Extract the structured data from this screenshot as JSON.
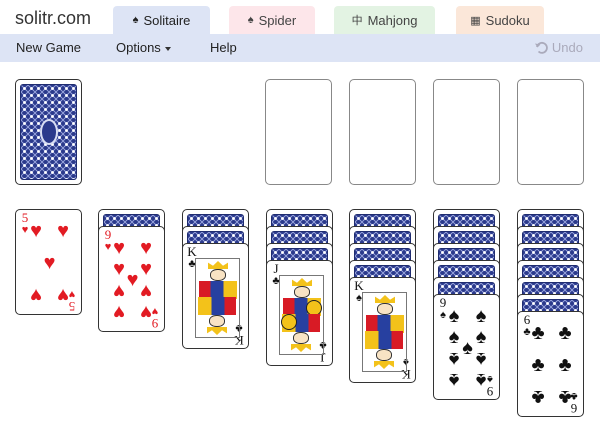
{
  "site": {
    "logo": "solitr.com"
  },
  "tabs": [
    {
      "label": "Solitaire",
      "icon": "spade-icon",
      "glyph": "♠",
      "active": true
    },
    {
      "label": "Spider",
      "icon": "spade-icon",
      "glyph": "♠",
      "active": false
    },
    {
      "label": "Mahjong",
      "icon": "mahjong-tile-icon",
      "glyph": "中",
      "active": false
    },
    {
      "label": "Sudoku",
      "icon": "grid-icon",
      "glyph": "▦",
      "active": false
    }
  ],
  "menu": {
    "new_game": "New Game",
    "options": "Options",
    "help": "Help",
    "undo": "Undo"
  },
  "colors": {
    "menubar": "#dde4f5",
    "card_back": "#2b3a8c",
    "red_suit": "#e21b23"
  },
  "game": {
    "stock": {
      "has_cards": true
    },
    "foundations": [
      {
        "empty": true
      },
      {
        "empty": true
      },
      {
        "empty": true
      },
      {
        "empty": true
      }
    ],
    "tableau": [
      {
        "face_down": 0,
        "face_up": [
          {
            "rank": "5",
            "suit": "♥",
            "color": "red"
          }
        ]
      },
      {
        "face_down": 1,
        "face_up": [
          {
            "rank": "9",
            "suit": "♥",
            "color": "red"
          }
        ]
      },
      {
        "face_down": 2,
        "face_up": [
          {
            "rank": "K",
            "suit": "♣",
            "color": "black"
          }
        ]
      },
      {
        "face_down": 3,
        "face_up": [
          {
            "rank": "J",
            "suit": "♣",
            "color": "black"
          }
        ]
      },
      {
        "face_down": 4,
        "face_up": [
          {
            "rank": "K",
            "suit": "♠",
            "color": "black"
          }
        ]
      },
      {
        "face_down": 5,
        "face_up": [
          {
            "rank": "9",
            "suit": "♠",
            "color": "black"
          }
        ]
      },
      {
        "face_down": 6,
        "face_up": [
          {
            "rank": "6",
            "suit": "♣",
            "color": "black"
          }
        ]
      }
    ]
  }
}
